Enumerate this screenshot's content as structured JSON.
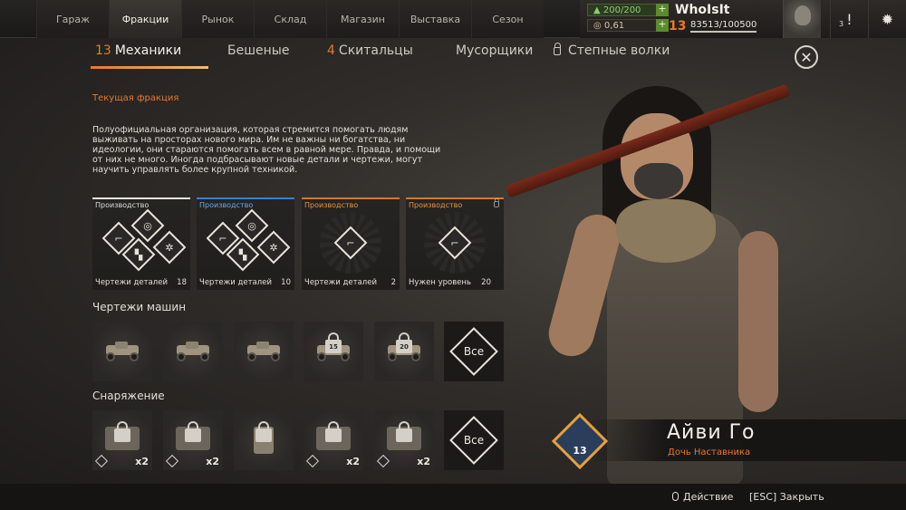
{
  "nav": {
    "tabs": [
      {
        "label": "Гараж"
      },
      {
        "label": "Фракции"
      },
      {
        "label": "Рынок"
      },
      {
        "label": "Склад"
      },
      {
        "label": "Магазин"
      },
      {
        "label": "Выставка"
      },
      {
        "label": "Сезон"
      }
    ],
    "active": "Фракции"
  },
  "player": {
    "fuel": "200/200",
    "coins": "0,61",
    "name": "WhoIsIt",
    "level": "13",
    "xp": "83513/100500",
    "notifications": "3"
  },
  "factions": {
    "tabs": [
      {
        "num": "13",
        "label": "Механики"
      },
      {
        "num": "",
        "label": "Бешеные"
      },
      {
        "num": "4",
        "label": "Скитальцы"
      },
      {
        "num": "",
        "label": "Мусорщики"
      },
      {
        "num": "",
        "label": "Степные волки"
      }
    ]
  },
  "current_label": "Текущая фракция",
  "description": "Полуофициальная организация, которая стремится помогать людям выживать на просторах нового мира. Им не важны ни богатства, ни идеологии, они стараются помогать всем в равной мере. Правда, и помощи от них не много. Иногда подбрасывают новые детали и чертежи, могут научить управлять более крупной техникой.",
  "production": [
    {
      "title": "Производство",
      "foot": "Чертежи деталей",
      "count": "18"
    },
    {
      "title": "Производство",
      "foot": "Чертежи деталей",
      "count": "10"
    },
    {
      "title": "Производство",
      "foot": "Чертежи деталей",
      "count": "2"
    },
    {
      "title": "Производство",
      "foot": "Нужен уровень",
      "count": "20"
    }
  ],
  "car_section": {
    "title": "Чертежи машин",
    "lock_levels": [
      "15",
      "20"
    ],
    "all_label": "Все"
  },
  "gear_section": {
    "title": "Снаряжение",
    "multipliers": [
      "x2",
      "x2",
      "x2",
      "x2"
    ],
    "all_label": "Все"
  },
  "character": {
    "level": "13",
    "name": "Айви Го",
    "role": "Дочь Наставника"
  },
  "hints": {
    "action": "Действие",
    "close": "[ESC] Закрыть"
  },
  "colors": {
    "accent": "#e8782e",
    "rare_blue": "#3a7fd0"
  }
}
